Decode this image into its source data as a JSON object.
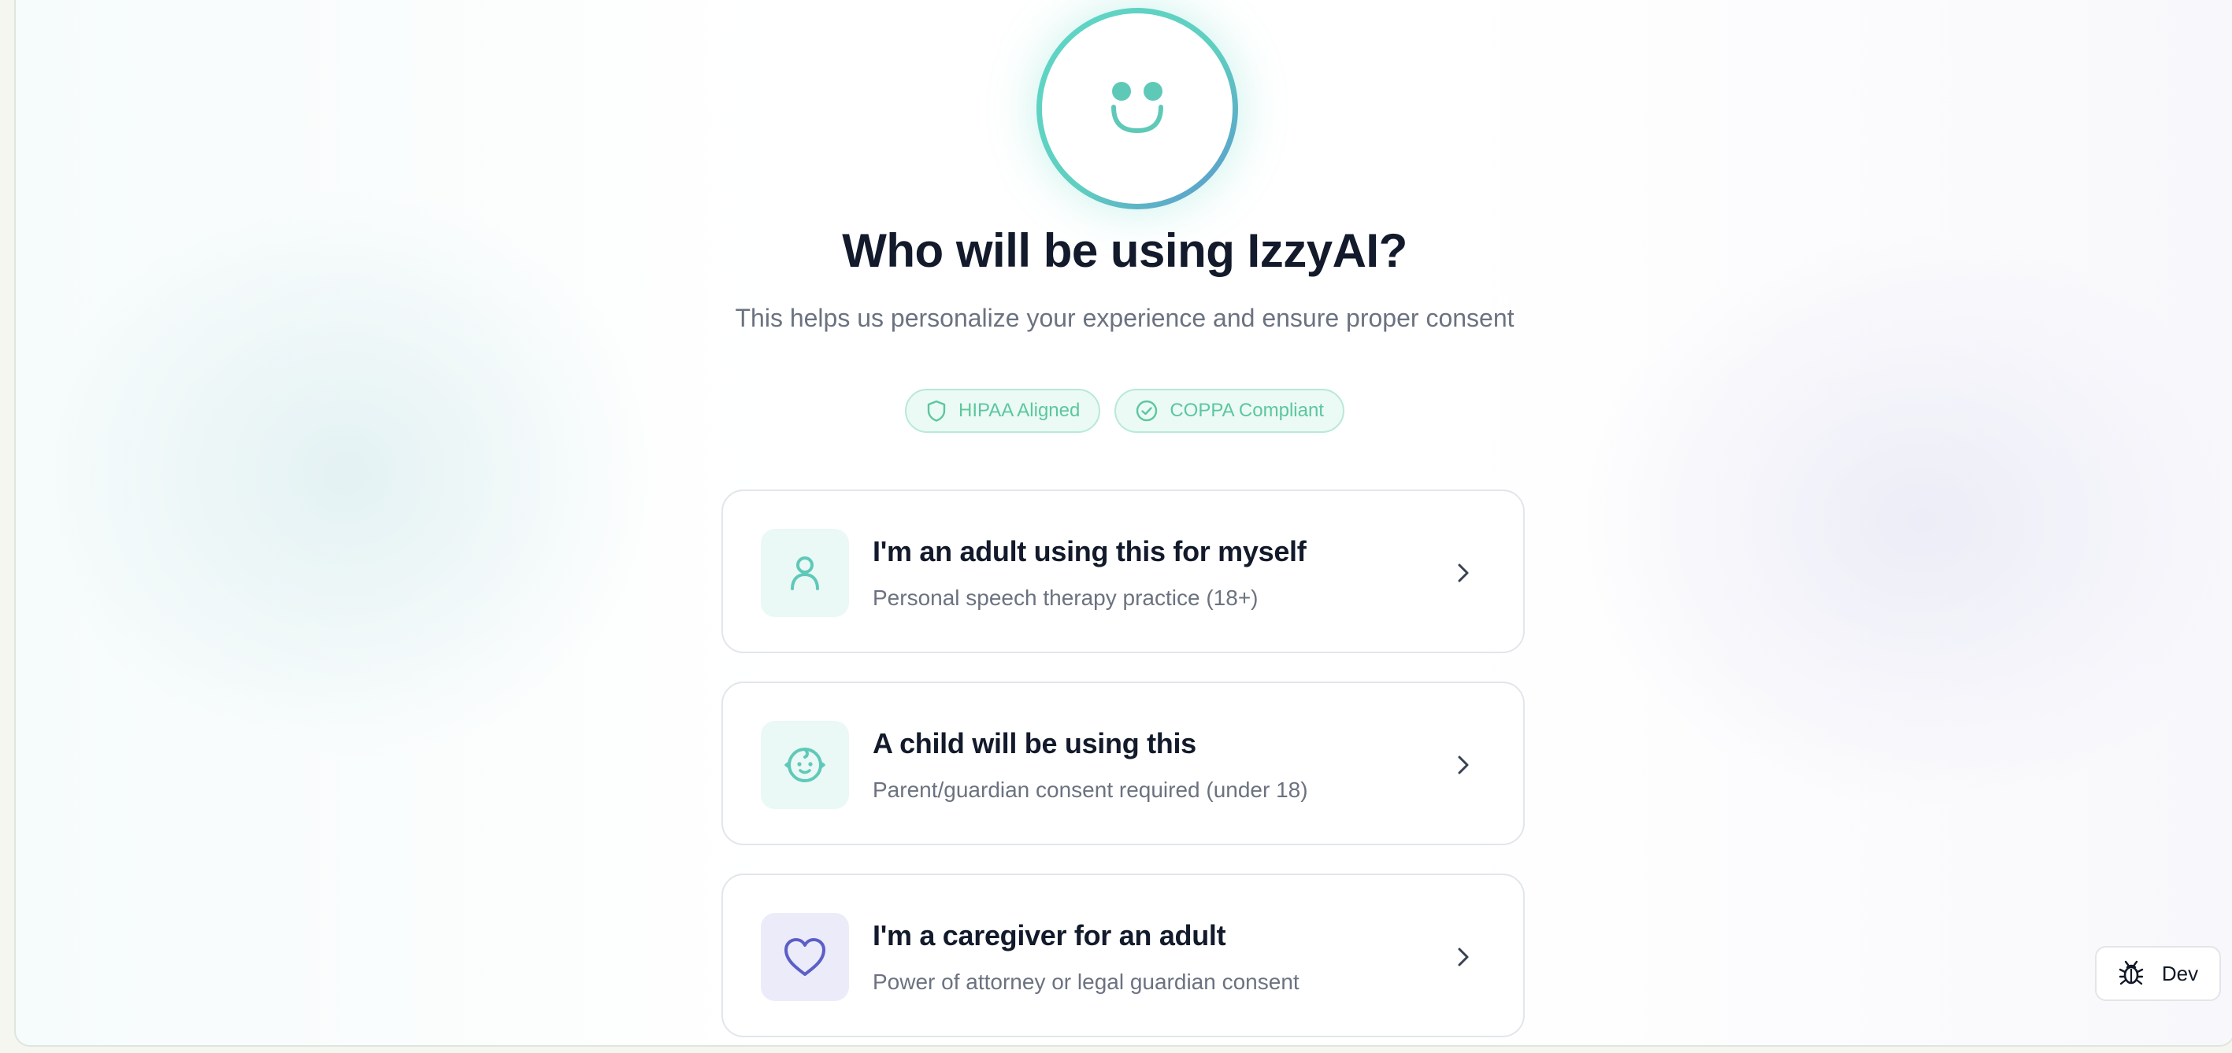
{
  "header": {
    "title": "Who will be using IzzyAI?",
    "subtitle": "This helps us personalize your experience and ensure proper consent"
  },
  "badges": [
    {
      "label": "HIPAA Aligned",
      "icon": "shield-icon"
    },
    {
      "label": "COPPA Compliant",
      "icon": "check-circle-icon"
    }
  ],
  "options": [
    {
      "title": "I'm an adult using this for myself",
      "subtitle": "Personal speech therapy practice (18+)",
      "icon": "user-icon"
    },
    {
      "title": "A child will be using this",
      "subtitle": "Parent/guardian consent required (under 18)",
      "icon": "baby-icon"
    },
    {
      "title": "I'm a caregiver for an adult",
      "subtitle": "Power of attorney or legal guardian consent",
      "icon": "heart-icon"
    }
  ],
  "dev_button": {
    "label": "Dev",
    "icon": "bug-icon"
  },
  "colors": {
    "accent_teal": "#5fd6c6",
    "accent_blue": "#5a93cf",
    "accent_violet": "#5b5fc7",
    "badge_green": "#5cc79f",
    "title": "#121a2b",
    "muted": "#6b7280"
  }
}
